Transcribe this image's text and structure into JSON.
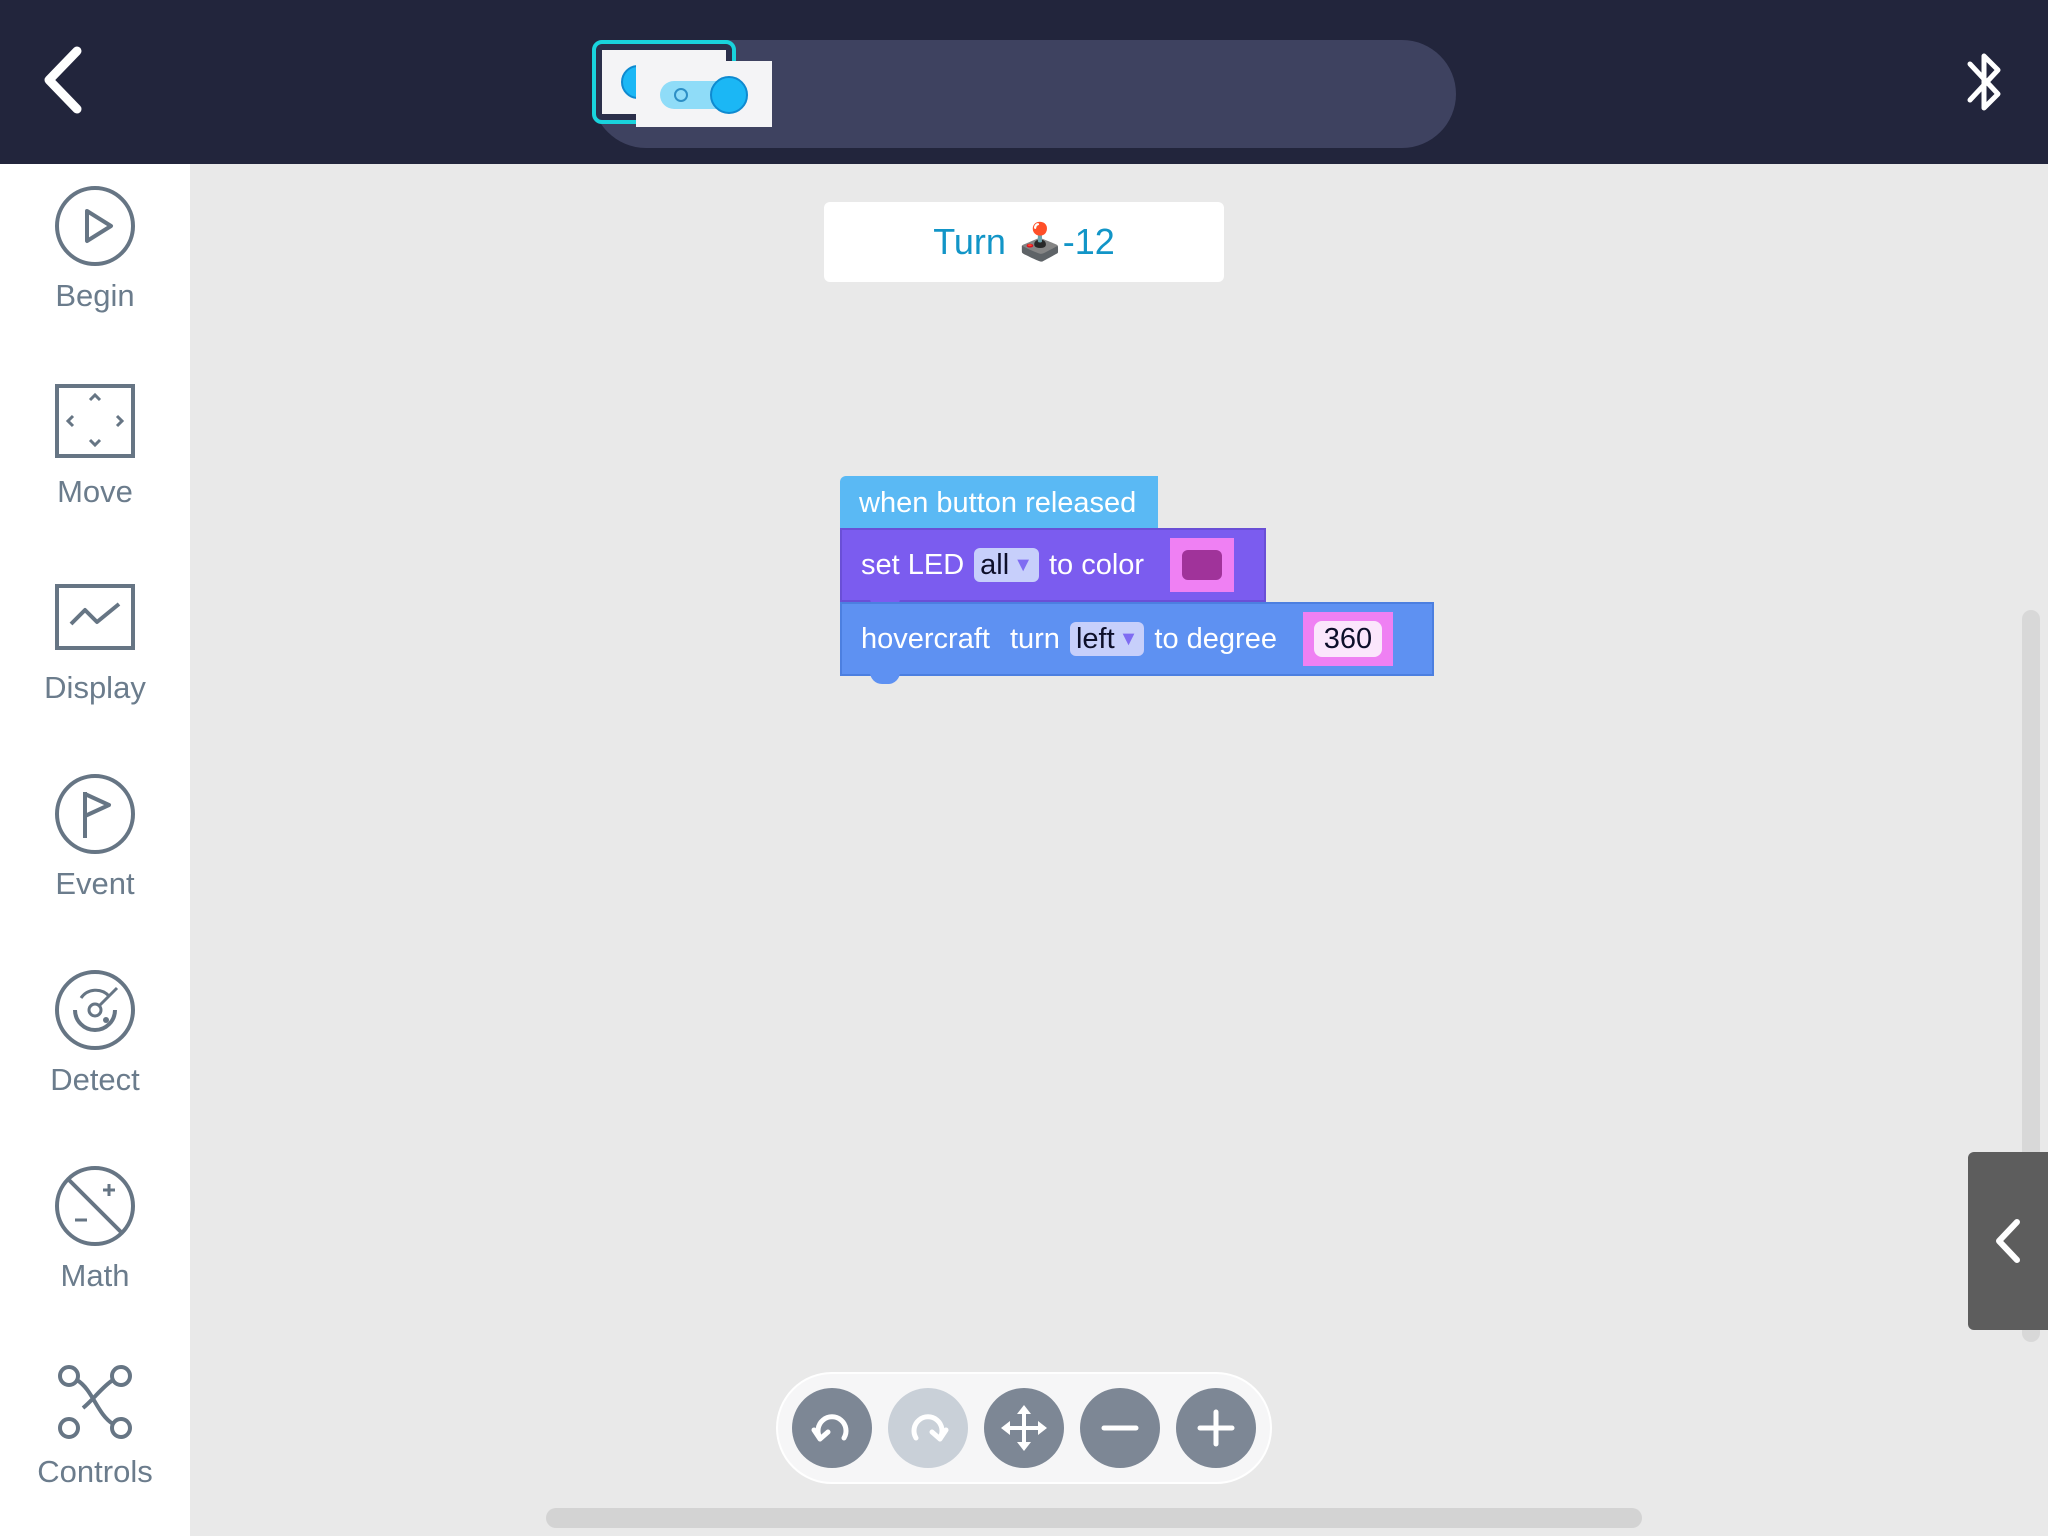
{
  "topbar": {
    "icons": {
      "back": "chevron-left-icon",
      "bluetooth": "bluetooth-icon"
    },
    "devices": [
      {
        "name": "switch-device",
        "selected": false
      },
      {
        "name": "button-device",
        "selected": true
      }
    ]
  },
  "sidebar": {
    "items": [
      {
        "label": "Begin",
        "icon": "play-circle-icon"
      },
      {
        "label": "Move",
        "icon": "move-arrows-icon"
      },
      {
        "label": "Display",
        "icon": "display-wave-icon"
      },
      {
        "label": "Event",
        "icon": "flag-icon"
      },
      {
        "label": "Detect",
        "icon": "radar-icon"
      },
      {
        "label": "Math",
        "icon": "math-icon"
      },
      {
        "label": "Controls",
        "icon": "controls-icon"
      }
    ]
  },
  "workspace": {
    "title_text": "Turn",
    "title_emoji": "🕹️",
    "title_suffix": "-12",
    "blocks": {
      "hat": {
        "text": "when button released"
      },
      "led": {
        "text_before": "set LED",
        "dropdown": "all",
        "text_after": "to color",
        "color": "#a0339a"
      },
      "turn": {
        "text_before": "hovercraft",
        "text_mid": "turn",
        "dropdown": "left",
        "text_after": "to degree",
        "value": "360"
      }
    }
  },
  "toolbar": {
    "tools": [
      {
        "name": "undo-button",
        "icon": "undo-icon",
        "enabled": true
      },
      {
        "name": "redo-button",
        "icon": "redo-icon",
        "enabled": false
      },
      {
        "name": "pan-button",
        "icon": "move-icon",
        "enabled": true
      },
      {
        "name": "zoom-out-button",
        "icon": "minus-icon",
        "enabled": true
      },
      {
        "name": "zoom-in-button",
        "icon": "plus-icon",
        "enabled": true
      }
    ]
  },
  "drawer": {
    "icon": "chevron-left-icon"
  },
  "colors": {
    "topbar": "#22253c",
    "accent": "#19d3dc",
    "hat_block": "#5ab9f4",
    "led_block": "#7b5cef",
    "motion_block": "#5e91f2"
  }
}
